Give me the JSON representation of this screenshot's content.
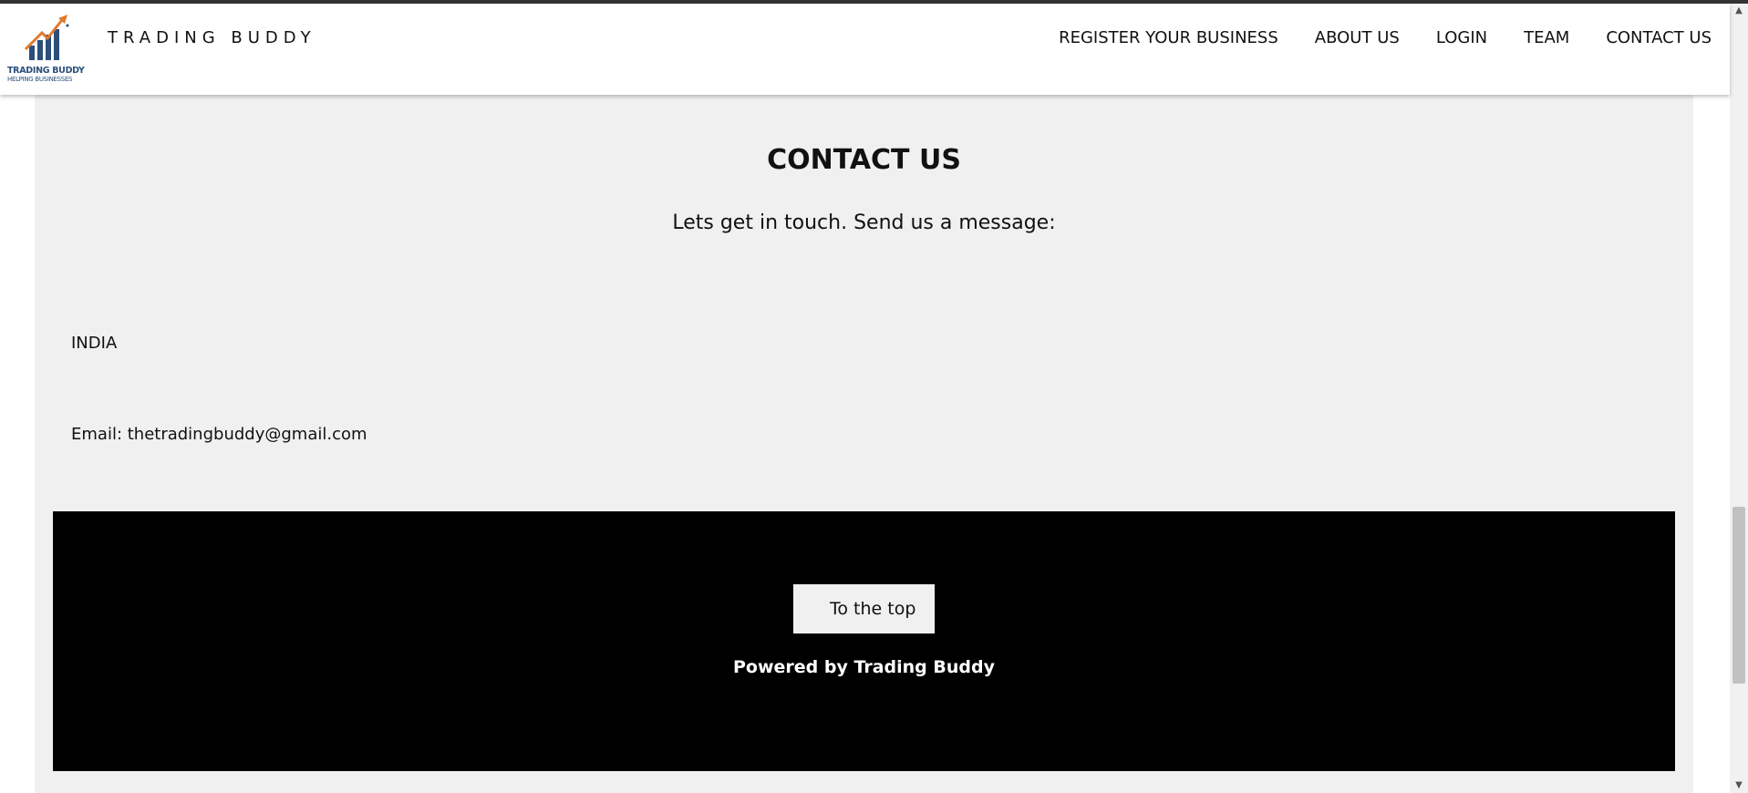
{
  "header": {
    "logo_line1": "TRADING BUDDY",
    "logo_line2": "HELPING BUSINESSES",
    "brand": "TRADING BUDDY",
    "nav": [
      {
        "label": "REGISTER YOUR BUSINESS"
      },
      {
        "label": "ABOUT US"
      },
      {
        "label": "LOGIN"
      },
      {
        "label": "TEAM"
      },
      {
        "label": "CONTACT US"
      }
    ]
  },
  "contact": {
    "title": "CONTACT US",
    "subtitle": "Lets get in touch. Send us a message:",
    "country": "INDIA",
    "email": "Email: thetradingbuddy@gmail.com"
  },
  "footer": {
    "top_button": "To the top",
    "powered_by": "Powered by Trading Buddy"
  },
  "scrollbar": {
    "up_icon": "chevron-up-icon",
    "down_icon": "chevron-down-icon"
  },
  "colors": {
    "logo_orange": "#e07a2e",
    "logo_blue": "#2b4f7a",
    "section_bg": "#f0f0f0",
    "footer_bg": "#000000"
  }
}
